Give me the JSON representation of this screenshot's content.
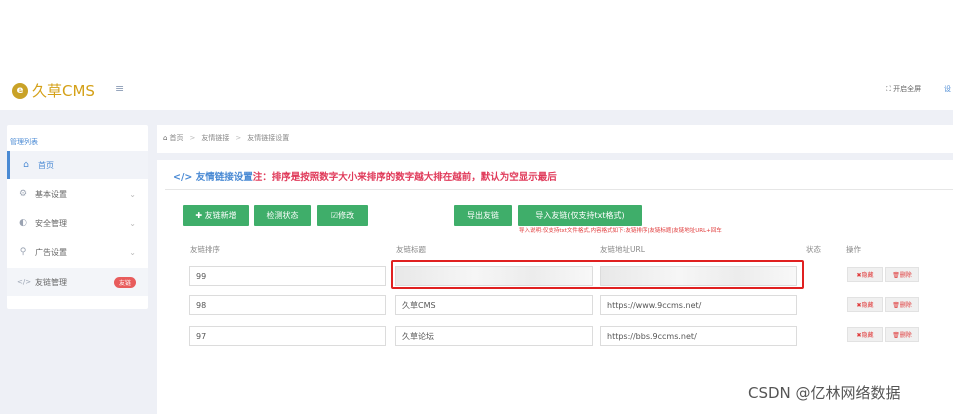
{
  "app": {
    "logo_mark": "e",
    "logo_text": "久草CMS",
    "menu_icon": "≡"
  },
  "topbar": {
    "fullscreen_label": "⛶ 开启全屏",
    "more": "设"
  },
  "sidebar": {
    "header": "管理列表",
    "items": [
      {
        "icon": "⌂",
        "label": "首页"
      },
      {
        "icon": "⚙",
        "label": "基本设置",
        "chevron": "⌄"
      },
      {
        "icon": "◐",
        "label": "安全管理",
        "chevron": "⌄"
      },
      {
        "icon": "⚲",
        "label": "广告设置",
        "chevron": "⌄"
      },
      {
        "icon": "</>",
        "label": "友链管理",
        "badge": "友链"
      }
    ]
  },
  "breadcrumb": {
    "home_icon": "⌂",
    "items": [
      "首页",
      "友情链接",
      "友情链接设置"
    ],
    "sep": ">"
  },
  "page": {
    "title_icon": "</>",
    "title_main": "友情链接设置",
    "title_note": "注：排序是按照数字大小来排序的数字越大排在越前，默认为空显示最后"
  },
  "toolbar": {
    "add": "✚ 友链新增",
    "check": "检测状态",
    "edit": "☑修改",
    "export": "导出友链",
    "import": "导入友链(仅支持txt格式)",
    "import_note": "导入说明:仅支持txt文件格式,内容格式如下:友链排序|友链标题|友链地址URL+回车"
  },
  "table": {
    "headers": [
      "友链排序",
      "友链标题",
      "友链地址URL",
      "状态",
      "操作"
    ],
    "rows": [
      {
        "order": "99",
        "title": "",
        "url": ""
      },
      {
        "order": "98",
        "title": "久草CMS",
        "url": "https://www.9ccms.net/"
      },
      {
        "order": "97",
        "title": "久草论坛",
        "url": "https://bbs.9ccms.net/"
      }
    ],
    "hide_label": "✖隐藏",
    "delete_label": "🗑删除"
  },
  "watermark": "CSDN @亿林网络数据"
}
